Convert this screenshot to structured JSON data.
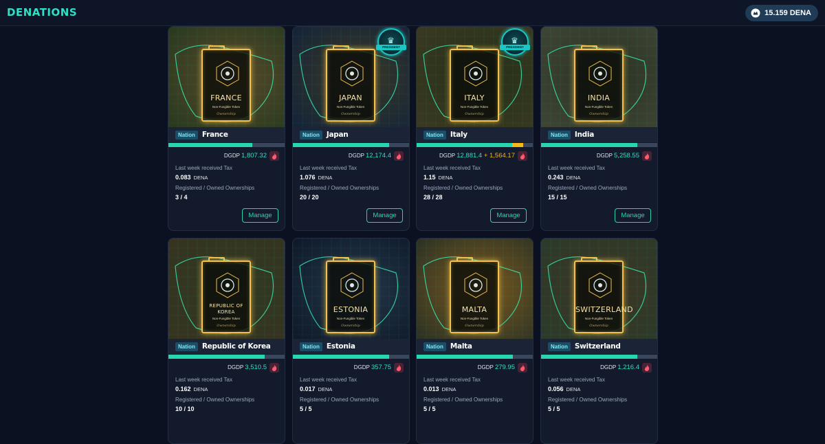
{
  "header": {
    "logo": "DENATIONS",
    "balance": "15.159 DENA",
    "balance_icon": "dena-token-icon"
  },
  "labels": {
    "tag": "Nation",
    "dgdp_prefix": "DGDP",
    "tax_label": "Last week received Tax",
    "tax_unit": "DENA",
    "own_label": "Registered / Owned Ownerships",
    "manage": "Manage",
    "nft_sub": "Non-Fungible Token",
    "nft_script": "Ownership",
    "badge_text": "PRESIDENT"
  },
  "colors": {
    "accent": "#27d6b0",
    "bonus": "#f5b71a",
    "frame": "#f2c14e",
    "badge": "#19c8c4"
  },
  "cards": [
    {
      "name": "France",
      "art_title": "FRANCE",
      "dgdp": "1,807.32",
      "bonus": "",
      "progress": 0.72,
      "bonus_progress": 0,
      "tax": "0.083",
      "ownerships": "3 / 4",
      "president": false
    },
    {
      "name": "Japan",
      "art_title": "JAPAN",
      "dgdp": "12,174.4",
      "bonus": "",
      "progress": 0.83,
      "bonus_progress": 0,
      "tax": "1.076",
      "ownerships": "20 / 20",
      "president": true
    },
    {
      "name": "Italy",
      "art_title": "ITALY",
      "dgdp": "12,881.4",
      "bonus": "+ 1,564.17",
      "progress": 0.82,
      "bonus_progress": 0.1,
      "tax": "1.15",
      "ownerships": "28 / 28",
      "president": true
    },
    {
      "name": "India",
      "art_title": "INDIA",
      "dgdp": "5,258.55",
      "bonus": "",
      "progress": 0.83,
      "bonus_progress": 0,
      "tax": "0.243",
      "ownerships": "15 / 15",
      "president": false
    },
    {
      "name": "Republic of Korea",
      "art_title": "REPUBLIC OF KOREA",
      "dgdp": "3,510.5",
      "bonus": "",
      "progress": 0.83,
      "bonus_progress": 0,
      "tax": "0.162",
      "ownerships": "10 / 10",
      "president": false
    },
    {
      "name": "Estonia",
      "art_title": "ESTONIA",
      "dgdp": "357.75",
      "bonus": "",
      "progress": 0.83,
      "bonus_progress": 0,
      "tax": "0.017",
      "ownerships": "5 / 5",
      "president": false
    },
    {
      "name": "Malta",
      "art_title": "MALTA",
      "dgdp": "279.95",
      "bonus": "",
      "progress": 0.83,
      "bonus_progress": 0,
      "tax": "0.013",
      "ownerships": "5 / 5",
      "president": false
    },
    {
      "name": "Switzerland",
      "art_title": "SWITZERLAND",
      "dgdp": "1,216.4",
      "bonus": "",
      "progress": 0.83,
      "bonus_progress": 0,
      "tax": "0.056",
      "ownerships": "5 / 5",
      "president": false
    }
  ]
}
